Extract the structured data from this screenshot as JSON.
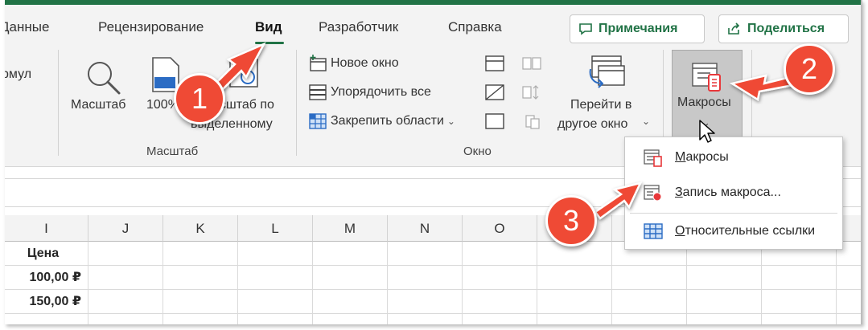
{
  "tabs": {
    "items": [
      {
        "label": "Данные"
      },
      {
        "label": "Рецензирование"
      },
      {
        "label": "Вид"
      },
      {
        "label": "Разработчик"
      },
      {
        "label": "Справка"
      }
    ],
    "active": "Вид",
    "comments_button": "Примечания",
    "share_button": "Поделиться"
  },
  "ribbon": {
    "partial_formula_label": "рмул",
    "zoom_group": {
      "label": "Масштаб",
      "zoom_button": "Масштаб",
      "zoom100_button": "100%",
      "zoom_selection_line1": "асштаб по",
      "zoom_selection_line2": "выделенному"
    },
    "window_group": {
      "label": "Окно",
      "new_window": "Новое окно",
      "arrange_all": "Упорядочить все",
      "freeze_panes": "Закрепить области",
      "switch_windows_line1": "Перейти в",
      "switch_windows_line2": "другое окно"
    },
    "macros_button": "Макросы"
  },
  "macros_menu": {
    "items": [
      {
        "label": "Макросы",
        "accel": "М",
        "rest": "акросы",
        "icon": "macro-list-icon"
      },
      {
        "label": "Запись макроса...",
        "accel": "З",
        "rest": "апись макроса...",
        "icon": "record-macro-icon"
      },
      {
        "label": "Относительные ссылки",
        "accel": "О",
        "rest": "тносительные ссылки",
        "icon": "relative-references-icon"
      }
    ]
  },
  "sheet": {
    "columns": [
      "I",
      "J",
      "K",
      "L",
      "M",
      "N",
      "O"
    ],
    "cells": [
      {
        "value": "Цена",
        "bold": true
      },
      {
        "value": "100,00 ₽",
        "bold": true
      },
      {
        "value": "150,00 ₽",
        "bold": true
      }
    ]
  },
  "annotations": [
    "1",
    "2",
    "3"
  ],
  "colors": {
    "accent": "#217346",
    "badge": "#ef4a35",
    "macro_red": "#e8373a"
  }
}
